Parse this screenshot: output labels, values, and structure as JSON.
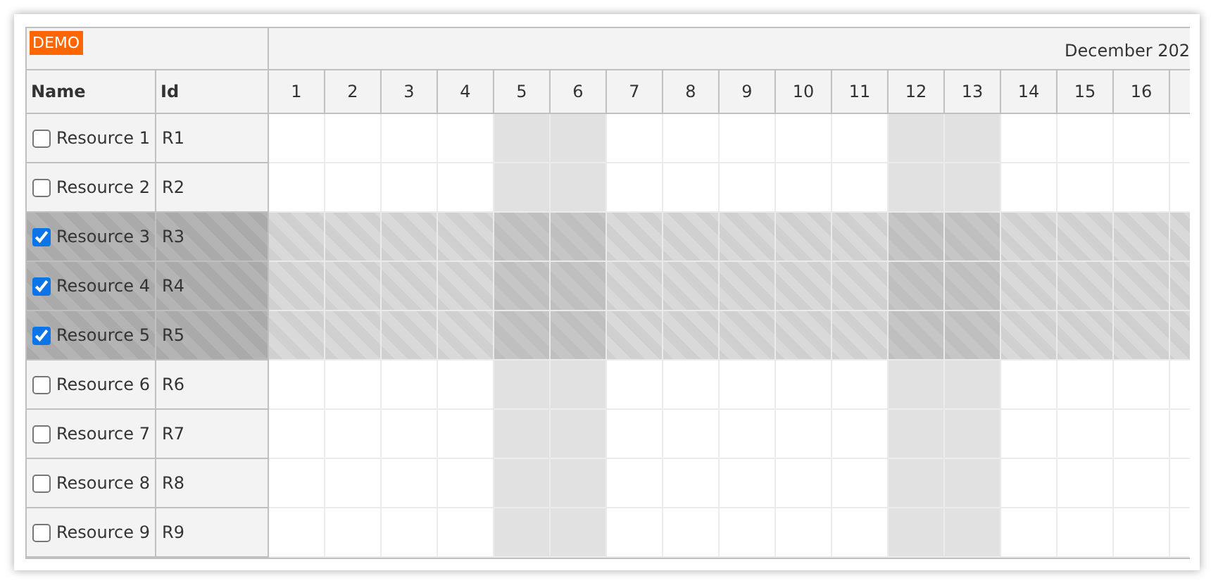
{
  "badge": "DEMO",
  "timeline_title": "December 202",
  "columns": [
    {
      "label": "Name"
    },
    {
      "label": "Id"
    }
  ],
  "days": [
    {
      "label": "1",
      "weekend": false
    },
    {
      "label": "2",
      "weekend": false
    },
    {
      "label": "3",
      "weekend": false
    },
    {
      "label": "4",
      "weekend": false
    },
    {
      "label": "5",
      "weekend": true
    },
    {
      "label": "6",
      "weekend": true
    },
    {
      "label": "7",
      "weekend": false
    },
    {
      "label": "8",
      "weekend": false
    },
    {
      "label": "9",
      "weekend": false
    },
    {
      "label": "10",
      "weekend": false
    },
    {
      "label": "11",
      "weekend": false
    },
    {
      "label": "12",
      "weekend": true
    },
    {
      "label": "13",
      "weekend": true
    },
    {
      "label": "14",
      "weekend": false
    },
    {
      "label": "15",
      "weekend": false
    },
    {
      "label": "16",
      "weekend": false
    }
  ],
  "rows": [
    {
      "name": "Resource 1",
      "id": "R1",
      "checked": false
    },
    {
      "name": "Resource 2",
      "id": "R2",
      "checked": false
    },
    {
      "name": "Resource 3",
      "id": "R3",
      "checked": true
    },
    {
      "name": "Resource 4",
      "id": "R4",
      "checked": true
    },
    {
      "name": "Resource 5",
      "id": "R5",
      "checked": true
    },
    {
      "name": "Resource 6",
      "id": "R6",
      "checked": false
    },
    {
      "name": "Resource 7",
      "id": "R7",
      "checked": false
    },
    {
      "name": "Resource 8",
      "id": "R8",
      "checked": false
    },
    {
      "name": "Resource 9",
      "id": "R9",
      "checked": false
    }
  ]
}
